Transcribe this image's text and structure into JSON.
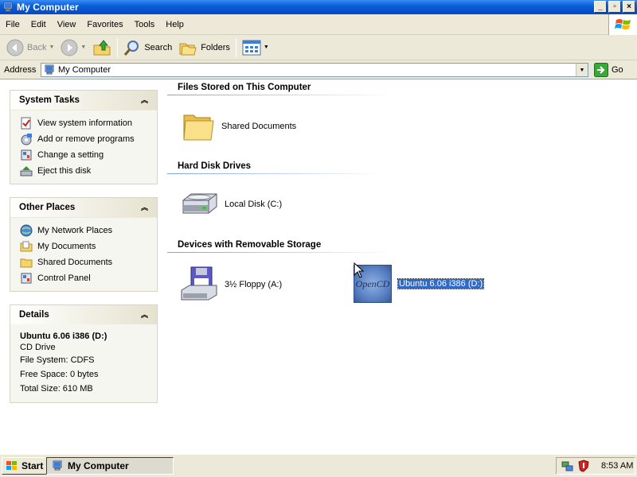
{
  "window": {
    "title": "My Computer",
    "buttons": [
      "minimize",
      "maximize",
      "close"
    ]
  },
  "menu": [
    "File",
    "Edit",
    "View",
    "Favorites",
    "Tools",
    "Help"
  ],
  "toolbar": {
    "back_label": "Back",
    "search_label": "Search",
    "folders_label": "Folders"
  },
  "address": {
    "label": "Address",
    "value": "My Computer",
    "go_label": "Go"
  },
  "system_tasks": {
    "title": "System Tasks",
    "items": [
      {
        "label": "View system information",
        "icon": "system-info-icon"
      },
      {
        "label": "Add or remove programs",
        "icon": "add-remove-icon"
      },
      {
        "label": "Change a setting",
        "icon": "control-panel-icon"
      },
      {
        "label": "Eject this disk",
        "icon": "eject-icon"
      }
    ]
  },
  "other_places": {
    "title": "Other Places",
    "items": [
      {
        "label": "My Network Places",
        "icon": "network-icon"
      },
      {
        "label": "My Documents",
        "icon": "folder-icon"
      },
      {
        "label": "Shared Documents",
        "icon": "folder-icon"
      },
      {
        "label": "Control Panel",
        "icon": "control-panel-icon"
      }
    ]
  },
  "details": {
    "title": "Details",
    "name": "Ubuntu 6.06 i386 (D:)",
    "type": "CD Drive",
    "file_system": "File System: CDFS",
    "free_space": "Free Space: 0 bytes",
    "total_size": "Total Size: 610 MB"
  },
  "groups": {
    "stored": {
      "title": "Files Stored on This Computer",
      "items": [
        {
          "label": "Shared Documents",
          "icon": "folder-icon"
        }
      ]
    },
    "hard_disks": {
      "title": "Hard Disk Drives",
      "items": [
        {
          "label": "Local Disk (C:)",
          "icon": "hard-disk-icon"
        }
      ]
    },
    "removable": {
      "title": "Devices with Removable Storage",
      "items": [
        {
          "label": "3½ Floppy (A:)",
          "icon": "floppy-icon"
        },
        {
          "label": "Ubuntu 6.06 i386 (D:)",
          "icon": "opencd-icon",
          "logo_text": "OpenCD",
          "selected": true
        }
      ]
    }
  },
  "taskbar": {
    "start_label": "Start",
    "task_label": "My Computer",
    "clock": "8:53 AM"
  },
  "colors": {
    "title_blue": "#0a5fd8",
    "selection": "#316ac5",
    "panel_bg": "#f6f6f0"
  }
}
